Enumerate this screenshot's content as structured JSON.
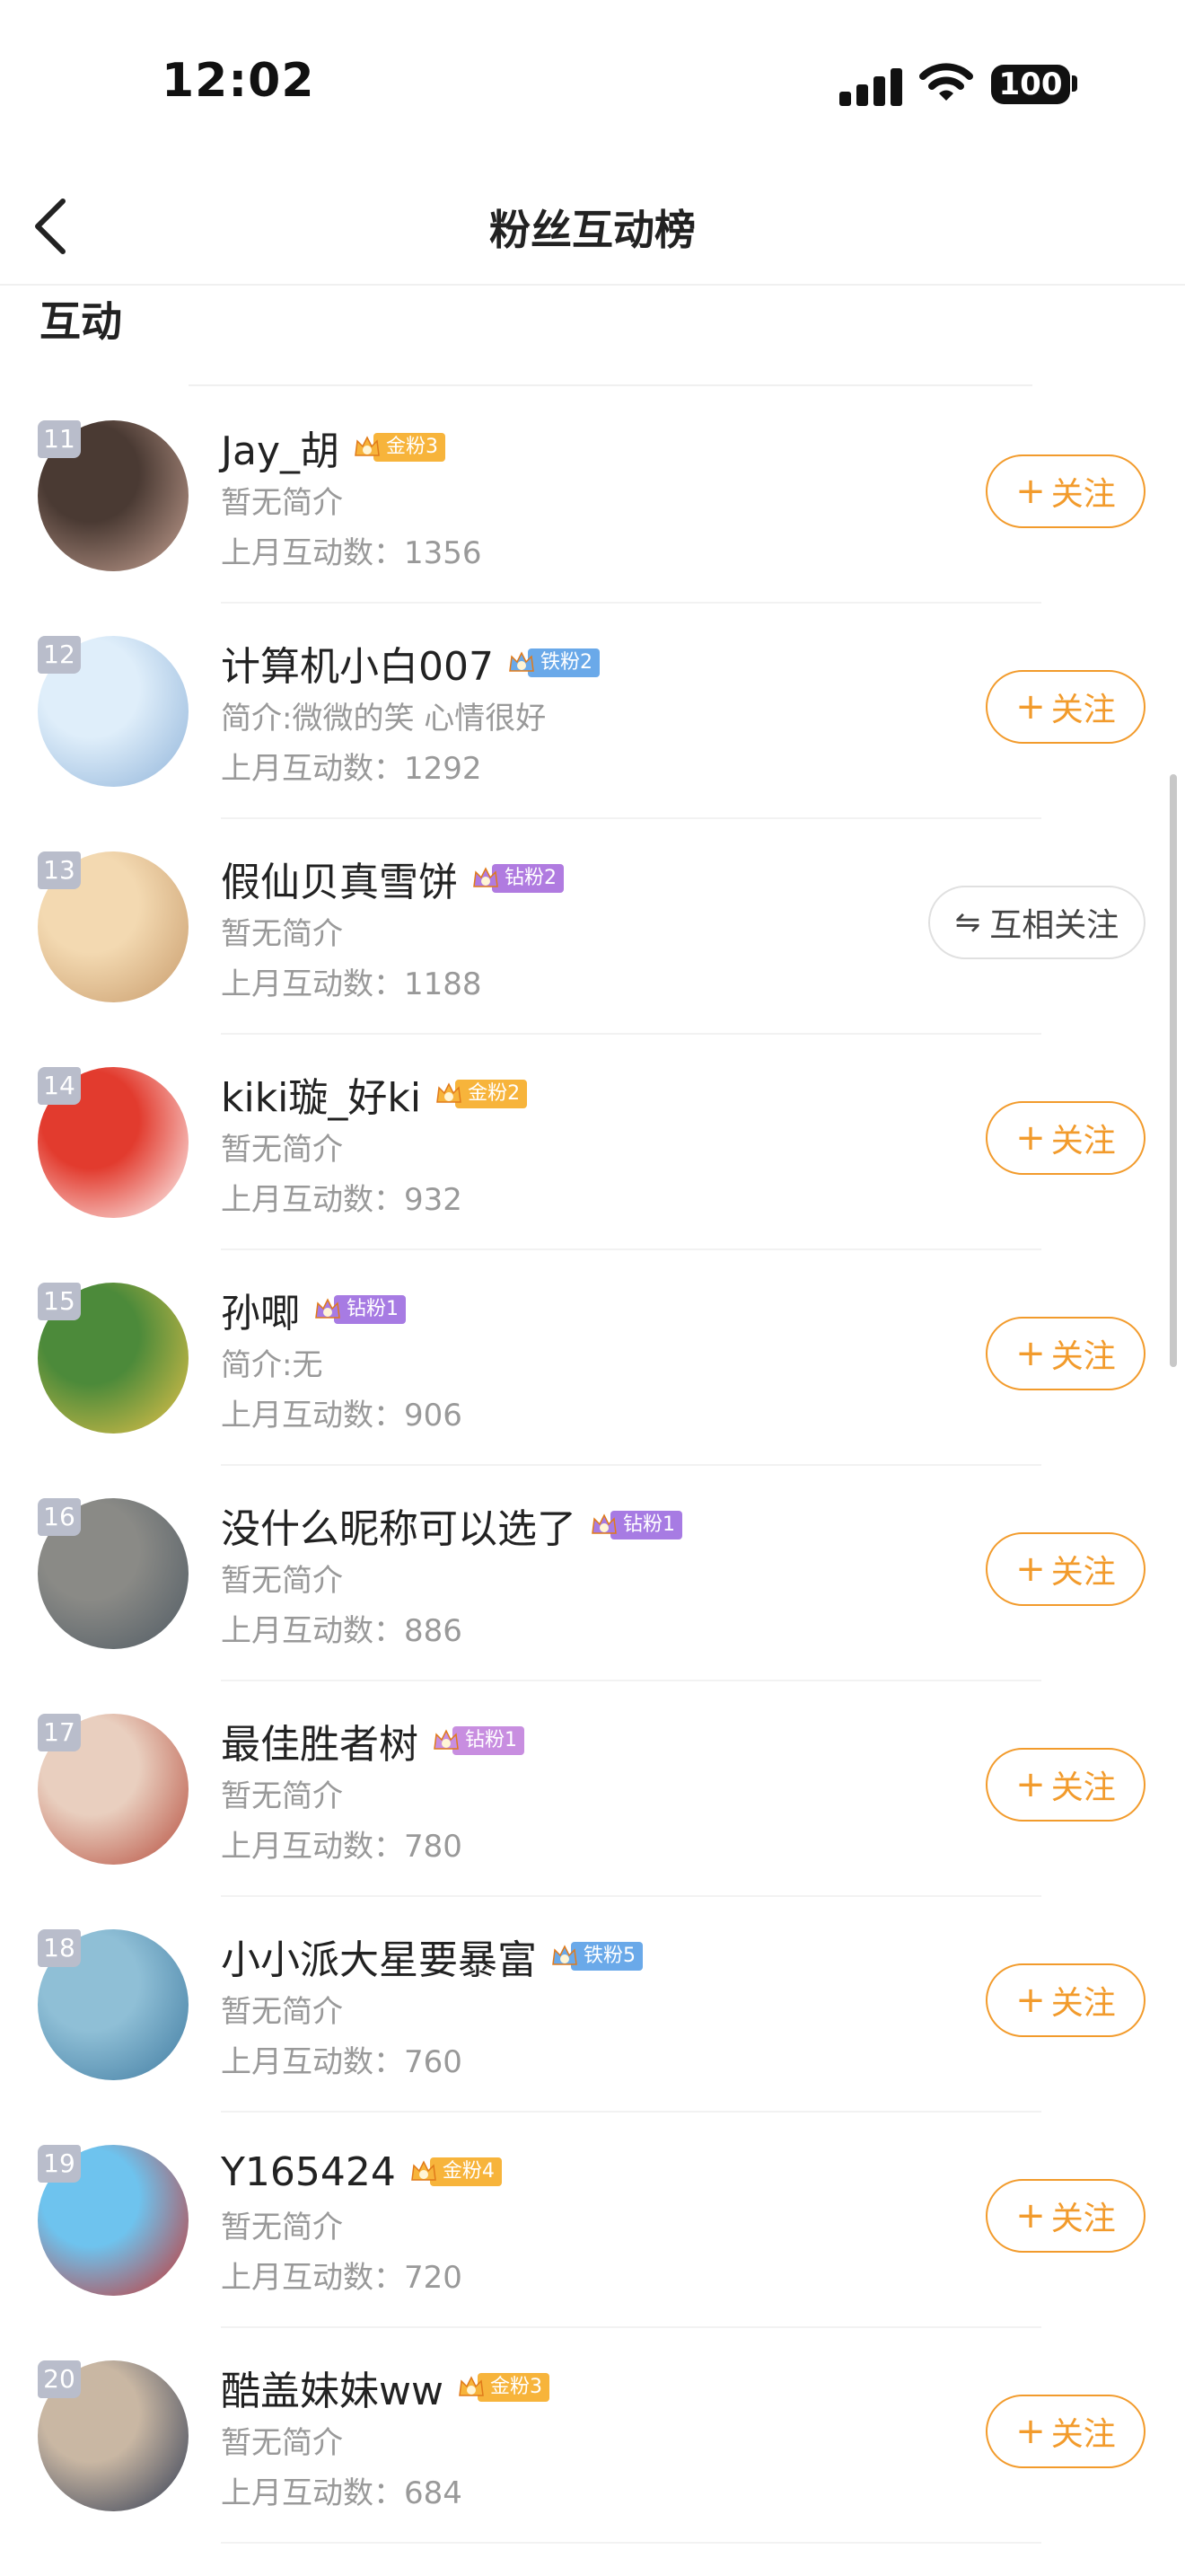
{
  "status_bar": {
    "time": "12:02",
    "battery": "100"
  },
  "nav": {
    "title": "粉丝互动榜"
  },
  "section": {
    "title": "互动"
  },
  "buttons": {
    "follow": "关注",
    "mutual": "互相关注"
  },
  "colors": {
    "accent": "#f29b2c",
    "rank_bg": "#b9bdcb",
    "muted_text": "#999999"
  },
  "fans": [
    {
      "rank": "11",
      "name": "Jay_胡",
      "badge": "金粉3",
      "badge_level": "1",
      "badge_color": "#f7b43b",
      "bio": "暂无简介",
      "count": "上月互动数：1356",
      "status": "follow",
      "avatar_colors": [
        "#4a3a33",
        "#c9a495"
      ]
    },
    {
      "rank": "12",
      "name": "计算机小白007",
      "badge": "铁粉2",
      "badge_level": "4",
      "badge_color": "#6aa9e9",
      "bio": "简介:微微的笑 心情很好",
      "count": "上月互动数：1292",
      "status": "follow",
      "avatar_colors": [
        "#dfeefa",
        "#8fb3d9"
      ]
    },
    {
      "rank": "13",
      "name": "假仙贝真雪饼",
      "badge": "钻粉2",
      "badge_level": "6",
      "badge_color": "#b07be0",
      "bio": "暂无简介",
      "count": "上月互动数：1188",
      "status": "mutual",
      "avatar_colors": [
        "#f3d9b1",
        "#c79a6a"
      ]
    },
    {
      "rank": "14",
      "name": "kiki璇_好ki",
      "badge": "金粉2",
      "badge_level": "2",
      "badge_color": "#f7b43b",
      "bio": "暂无简介",
      "count": "上月互动数：932",
      "status": "follow",
      "avatar_colors": [
        "#e23b2e",
        "#ffffff"
      ]
    },
    {
      "rank": "15",
      "name": "孙唧",
      "badge": "钻粉1",
      "badge_level": "",
      "badge_color": "#a77be3",
      "bio": "简介:无",
      "count": "上月互动数：906",
      "status": "follow",
      "avatar_colors": [
        "#4c8a3a",
        "#e9c44a"
      ]
    },
    {
      "rank": "16",
      "name": "没什么昵称可以选了",
      "badge": "钻粉1",
      "badge_level": "",
      "badge_color": "#a77be3",
      "bio": "暂无简介",
      "count": "上月互动数：886",
      "status": "follow",
      "avatar_colors": [
        "#8a8a86",
        "#4f5a63"
      ]
    },
    {
      "rank": "17",
      "name": "最佳胜者树",
      "badge": "钻粉1",
      "badge_level": "5",
      "badge_color": "#c88ee0",
      "bio": "暂无简介",
      "count": "上月互动数：780",
      "status": "follow",
      "avatar_colors": [
        "#e9cfbf",
        "#b54a3a"
      ]
    },
    {
      "rank": "18",
      "name": "小小派大星要暴富",
      "badge": "铁粉5",
      "badge_level": "2",
      "badge_color": "#6aa9e9",
      "bio": "暂无简介",
      "count": "上月互动数：760",
      "status": "follow",
      "avatar_colors": [
        "#8fbfd6",
        "#3f7aa0"
      ]
    },
    {
      "rank": "19",
      "name": "Y165424",
      "badge": "金粉4",
      "badge_level": "3",
      "badge_color": "#f7b43b",
      "bio": "暂无简介",
      "count": "上月互动数：720",
      "status": "follow",
      "avatar_colors": [
        "#6ec3ee",
        "#c9302c"
      ]
    },
    {
      "rank": "20",
      "name": "酷盖妹妹ww",
      "badge": "金粉3",
      "badge_level": "6",
      "badge_color": "#f7b43b",
      "bio": "暂无简介",
      "count": "上月互动数：684",
      "status": "follow",
      "avatar_colors": [
        "#c9b7a3",
        "#2f3a52"
      ]
    }
  ]
}
